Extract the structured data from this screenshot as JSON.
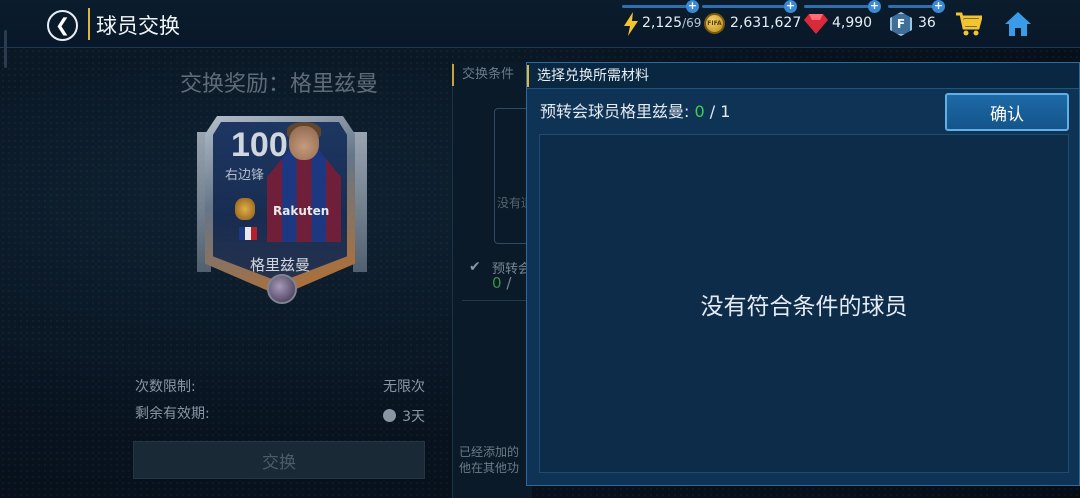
{
  "header": {
    "title": "球员交换",
    "resources": {
      "energy": {
        "value": "2,125",
        "max": "/69"
      },
      "coins": {
        "value": "2,631,627",
        "icon_text": "FIFA"
      },
      "gems": {
        "value": "4,990"
      },
      "fpoints": {
        "value": "36",
        "icon_text": "F"
      }
    }
  },
  "reward": {
    "title": "交换奖励：格里兹曼",
    "card": {
      "rating": "100",
      "position": "右边锋",
      "name": "格里兹曼",
      "sponsor": "Rakuten"
    },
    "limit_label": "次数限制:",
    "limit_value": "无限次",
    "validity_label": "剩余有效期:",
    "validity_value": "3天",
    "exchange_button": "交换"
  },
  "conditions": {
    "tab_label": "交换条件",
    "box_text": "没有适",
    "req_short": "预转会",
    "req_count": "0",
    "req_slash": " / ",
    "bottom_line1": "已经添加的",
    "bottom_line2": "他在其他功"
  },
  "selection": {
    "title": "选择兑换所需材料",
    "requirement_label": "预转会球员格里兹曼: ",
    "requirement_current": "0",
    "requirement_total": " / 1",
    "confirm_button": "确认",
    "empty_message": "没有符合条件的球员"
  },
  "colors": {
    "accent_gold": "#e0b63a",
    "panel_blue": "#0e3354",
    "count_green": "#3fcf56"
  }
}
